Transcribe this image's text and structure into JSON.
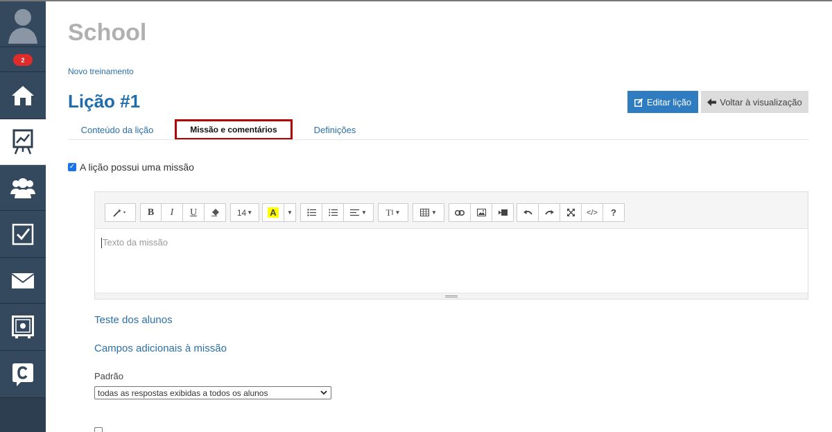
{
  "app": {
    "title": "School"
  },
  "sidebar": {
    "notification_count": "2",
    "items": [
      {
        "name": "avatar",
        "icon": "user-icon"
      },
      {
        "name": "home",
        "icon": "home-icon"
      },
      {
        "name": "statistics",
        "icon": "chart-board-icon"
      },
      {
        "name": "team",
        "icon": "users-icon"
      },
      {
        "name": "tasks",
        "icon": "checkbox-icon"
      },
      {
        "name": "messages",
        "icon": "mail-icon"
      },
      {
        "name": "safe",
        "icon": "safe-icon"
      },
      {
        "name": "c-app",
        "icon": "c-logo-icon"
      }
    ]
  },
  "breadcrumb": "Novo treinamento",
  "page_title": "Lição #1",
  "actions": {
    "edit_label": "Editar lição",
    "back_label": "Voltar à visualização"
  },
  "tabs": [
    {
      "label": "Conteúdo da lição"
    },
    {
      "label": "Missão e comentários"
    },
    {
      "label": "Definições"
    }
  ],
  "mission": {
    "checkbox_label": "A lição possui uma missão",
    "checked": true
  },
  "editor": {
    "font_size": "14",
    "placeholder": "Texto da missão",
    "toolbar_icons": [
      "magic-wand-icon",
      "bold-icon",
      "italic-icon",
      "underline-icon",
      "eraser-icon",
      "font-size-select",
      "highlight-icon",
      "unordered-list-icon",
      "ordered-list-icon",
      "align-icon",
      "text-style-icon",
      "table-icon",
      "link-icon",
      "image-icon",
      "video-icon",
      "undo-icon",
      "redo-icon",
      "fullscreen-icon",
      "code-view-icon",
      "help-icon"
    ]
  },
  "links": {
    "student_test": "Teste dos alunos",
    "additional_fields": "Campos adicionais à missão"
  },
  "default_field": {
    "label": "Padrão",
    "selected": "todas as respostas exibidas a todos os alunos"
  },
  "colors": {
    "sidebar_bg": "#34495e",
    "accent_blue": "#2f7cc0",
    "title_blue": "#1f6cad",
    "highlight_red": "#b40000",
    "badge_red": "#e02b2b"
  }
}
